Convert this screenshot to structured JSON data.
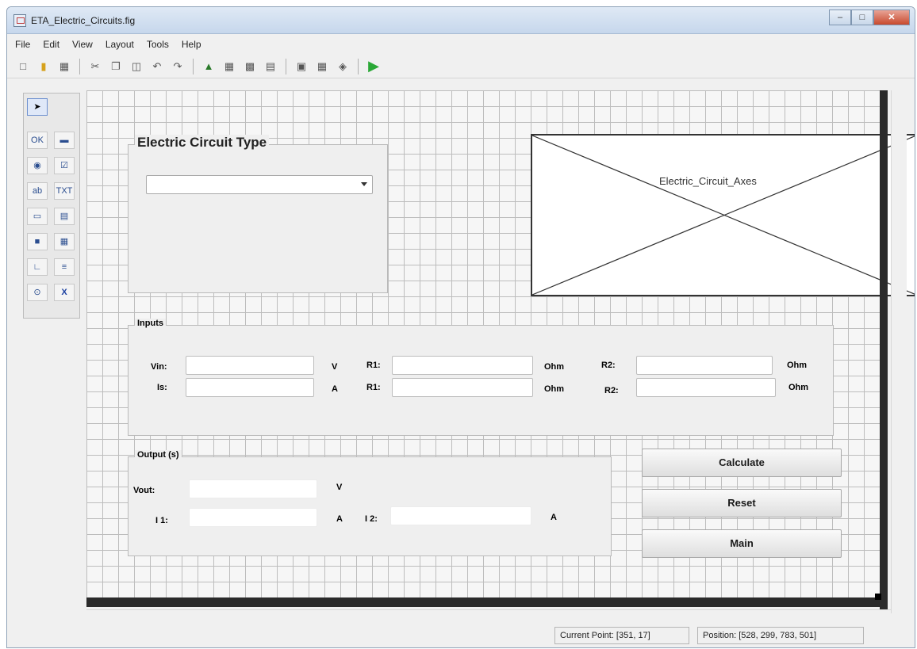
{
  "window": {
    "title": "ETA_Electric_Circuits.fig"
  },
  "menu": [
    "File",
    "Edit",
    "View",
    "Layout",
    "Tools",
    "Help"
  ],
  "toolbar_icons": [
    "new-file-icon",
    "open-folder-icon",
    "save-icon",
    "cut-icon",
    "copy-icon",
    "paste-icon",
    "undo-icon",
    "redo-icon",
    "align-icon",
    "editor-icon",
    "tab-order-icon",
    "menu-editor-icon",
    "mfile-icon",
    "inspector-icon",
    "object-browser-icon",
    "run-icon"
  ],
  "palette_icons": [
    "select-arrow-icon",
    "push-button-icon",
    "slider-icon",
    "radio-button-icon",
    "checkbox-icon",
    "edit-text-icon",
    "static-text-icon",
    "popup-menu-icon",
    "listbox-icon",
    "toggle-button-icon",
    "table-icon",
    "axes-icon",
    "panel-icon",
    "button-group-icon",
    "activex-icon"
  ],
  "circuit_panel": {
    "title": "Electric Circuit Type",
    "popup_value": ""
  },
  "axes": {
    "label": "Electric_Circuit_Axes"
  },
  "inputs_panel": {
    "title": "Inputs",
    "row1": {
      "vin_label": "Vin:",
      "vin_unit": "V",
      "r1_label": "R1:",
      "r1_unit": "Ohm",
      "r2_label": "R2:",
      "r2_unit": "Ohm"
    },
    "row2": {
      "is_label": "Is:",
      "is_unit": "A",
      "r1_label": "R1:",
      "r1_unit": "Ohm",
      "r2_label": "R2:",
      "r2_unit": "Ohm"
    }
  },
  "output_panel": {
    "title": "Output (s)",
    "vout_label": "Vout:",
    "vout_unit": "V",
    "i1_label": "I 1:",
    "i1_unit": "A",
    "i2_label": "I 2:",
    "i2_unit": "A"
  },
  "buttons": {
    "calculate": "Calculate",
    "reset": "Reset",
    "main": "Main"
  },
  "status": {
    "current_point": "Current Point:  [351, 17]",
    "position": "Position:  [528, 299, 783, 501]"
  },
  "colors": {
    "accent_run": "#2aa836",
    "close_button": "#c84a2e"
  }
}
